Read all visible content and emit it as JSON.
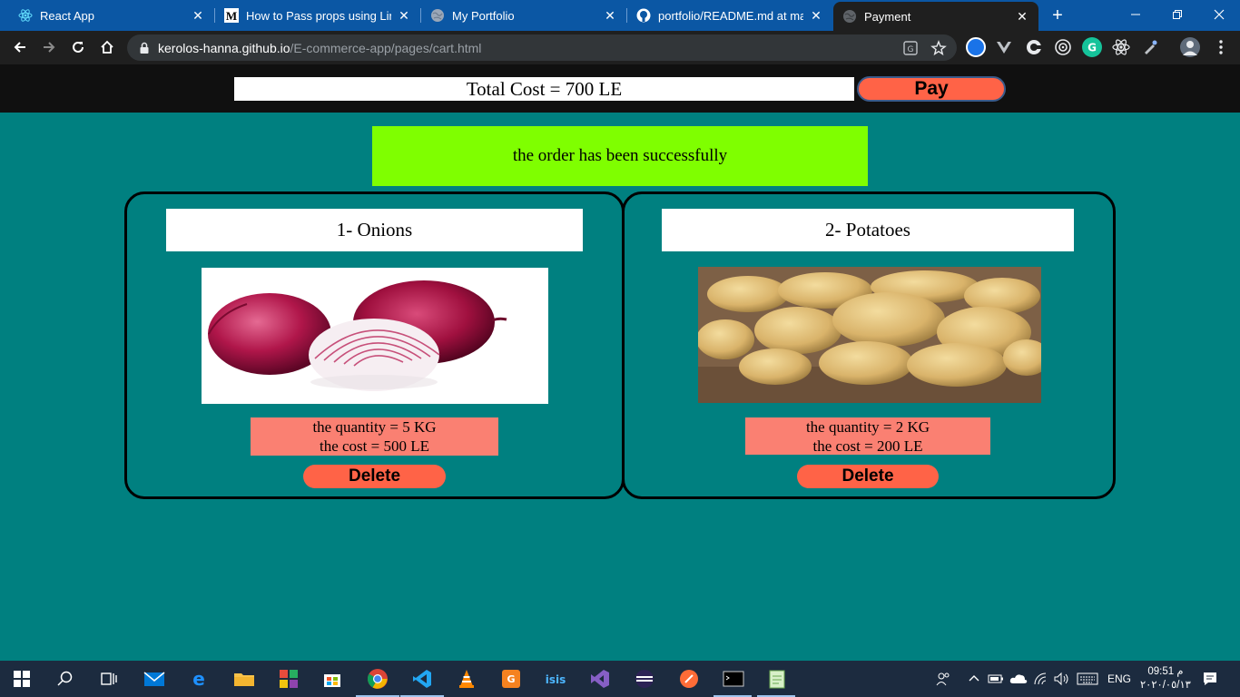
{
  "browser": {
    "tabs": [
      {
        "title": "React App",
        "icon": "react-icon"
      },
      {
        "title": "How to Pass props using Link a",
        "icon": "medium-icon"
      },
      {
        "title": "My Portfolio",
        "icon": "globe-icon"
      },
      {
        "title": "portfolio/README.md at maste",
        "icon": "github-icon"
      },
      {
        "title": "Payment",
        "icon": "globe-icon",
        "active": true
      }
    ],
    "url_host": "kerolos-hanna.github.io",
    "url_path": "/E-commerce-app/pages/cart.html"
  },
  "header": {
    "total_cost": "Total Cost = 700 LE",
    "pay_label": "Pay"
  },
  "message": "the order has been successfully",
  "products": [
    {
      "title": "1- Onions",
      "quantity": "the quantity = 5 KG",
      "cost": "the cost = 500 LE",
      "delete_label": "Delete",
      "image": "onions-image"
    },
    {
      "title": "2- Potatoes",
      "quantity": "the quantity = 2 KG",
      "cost": "the cost = 200 LE",
      "delete_label": "Delete",
      "image": "potatoes-image"
    }
  ],
  "taskbar": {
    "language": "ENG",
    "time": "09:51 م",
    "date": "٢٠٢٠/٠٥/١٣"
  },
  "colors": {
    "page_background": "#008080",
    "header_background": "#101010",
    "button": "#ff6347",
    "success": "#7fff00",
    "info_box": "#fa8072"
  }
}
